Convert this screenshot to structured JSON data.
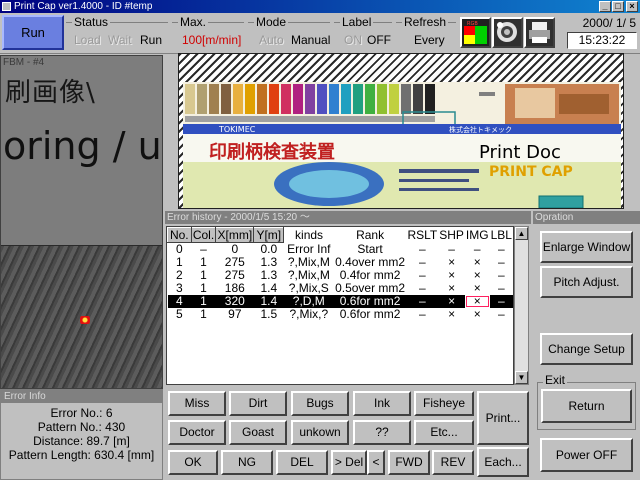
{
  "window": {
    "title": "Print Cap ver1.4000 - ID #temp",
    "controls": [
      "_",
      "□",
      "×"
    ]
  },
  "toolbar": {
    "run_label": "Run",
    "status": {
      "label": "Status",
      "options": [
        "Load",
        "Wait",
        "Run"
      ]
    },
    "max": {
      "label": "Max.",
      "value": "100[m/min]"
    },
    "mode": {
      "label": "Mode",
      "options": [
        "Auto",
        "Manual"
      ]
    },
    "label_group": {
      "label": "Label",
      "options": [
        "ON",
        "OFF"
      ]
    },
    "refresh": {
      "label": "Refresh",
      "value": "Every"
    },
    "icons": [
      {
        "name": "rgb-icon",
        "text": "RGB"
      },
      {
        "name": "camera-icon"
      },
      {
        "name": "printer-icon"
      }
    ],
    "date": "2000/ 1/ 5",
    "time": "15:23:22"
  },
  "camera": {
    "label": "FBM - #4",
    "line1": "刷画像\\",
    "line2": "oring / u"
  },
  "error_info": {
    "header": "Error Info",
    "error_no": "Error No.: 6",
    "pattern_no": "Pattern No.: 430",
    "distance": "Distance: 89.7 [m]",
    "pattern_length": "Pattern Length: 630.4 [mm]"
  },
  "image_view": {
    "banner1": "印刷柄検査装置",
    "banner1_right": "Print Doc",
    "banner2": "PRINT CAP",
    "banner_small": "TOKIMEC",
    "banner_small2": "株式会社トキメック"
  },
  "history": {
    "header": "Error history - 2000/1/5 15:20 ～",
    "columns": [
      "No.",
      "Col.",
      "X[mm]",
      "Y[m]",
      "kinds",
      "Rank",
      "RSLT",
      "SHP",
      "IMG",
      "LBL"
    ],
    "rows": [
      [
        "0",
        "–",
        "0",
        "0.0",
        "Error Inf",
        "Start",
        "–",
        "–",
        "–",
        "–"
      ],
      [
        "1",
        "1",
        "275",
        "1.3",
        "?,Mix,M",
        "0.4over mm2",
        "–",
        "×",
        "×",
        "–"
      ],
      [
        "2",
        "1",
        "275",
        "1.3",
        "?,Mix,M",
        "0.4for mm2",
        "–",
        "×",
        "×",
        "–"
      ],
      [
        "3",
        "1",
        "186",
        "1.4",
        "?,Mix,S",
        "0.5over mm2",
        "–",
        "×",
        "×",
        "–"
      ],
      [
        "4",
        "1",
        "320",
        "1.4",
        "?,D,M",
        "0.6for mm2",
        "–",
        "×",
        "×",
        "–"
      ],
      [
        "5",
        "1",
        "97",
        "1.5",
        "?,Mix,?",
        "0.6for mm2",
        "–",
        "×",
        "×",
        "–"
      ]
    ],
    "selected_row": 4
  },
  "operation": {
    "header": "Opration",
    "enlarge": "Enlarge Window",
    "pitch": "Pitch Adjust.",
    "change_setup": "Change Setup",
    "exit_label": "Exit",
    "return": "Return",
    "power_off": "Power OFF"
  },
  "buttons": {
    "row1": [
      "Miss",
      "Dirt",
      "Bugs",
      "Ink",
      "Fisheye"
    ],
    "row2": [
      "Doctor",
      "Goast",
      "unkown",
      "??",
      "Etc..."
    ],
    "row3": [
      "OK",
      "NG",
      "DEL",
      "> Del",
      "<",
      "FWD",
      "REV"
    ],
    "print": "Print...",
    "each": "Each..."
  }
}
